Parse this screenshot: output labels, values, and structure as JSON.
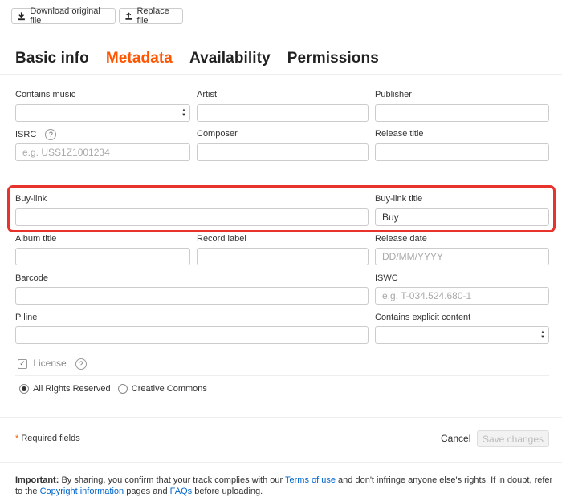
{
  "toolbar": {
    "download_label": "Download original file",
    "replace_label": "Replace file"
  },
  "tabs": [
    "Basic info",
    "Metadata",
    "Availability",
    "Permissions"
  ],
  "active_tab": "Metadata",
  "fields": {
    "contains_music": {
      "label": "Contains music",
      "value": ""
    },
    "artist": {
      "label": "Artist",
      "value": ""
    },
    "publisher": {
      "label": "Publisher",
      "value": ""
    },
    "isrc": {
      "label": "ISRC",
      "placeholder": "e.g. USS1Z1001234"
    },
    "composer": {
      "label": "Composer",
      "value": ""
    },
    "release_title": {
      "label": "Release title",
      "value": ""
    },
    "buy_link": {
      "label": "Buy-link",
      "value": ""
    },
    "buy_link_title": {
      "label": "Buy-link title",
      "value": "Buy"
    },
    "album_title": {
      "label": "Album title",
      "value": ""
    },
    "record_label": {
      "label": "Record label",
      "value": ""
    },
    "release_date": {
      "label": "Release date",
      "placeholder": "DD/MM/YYYY"
    },
    "barcode": {
      "label": "Barcode",
      "value": ""
    },
    "iswc": {
      "label": "ISWC",
      "placeholder": "e.g. T-034.524.680-1"
    },
    "p_line": {
      "label": "P line",
      "value": ""
    },
    "explicit": {
      "label": "Contains explicit content",
      "value": ""
    }
  },
  "license": {
    "label": "License",
    "options": [
      "All Rights Reserved",
      "Creative Commons"
    ],
    "selected": "All Rights Reserved"
  },
  "footer": {
    "required_star": "*",
    "required_text": "Required fields",
    "cancel_label": "Cancel",
    "save_label": "Save changes"
  },
  "notice": {
    "important": "Important:",
    "text1": " By sharing, you confirm that your track complies with our ",
    "terms_link": "Terms of use",
    "text2": " and don't infringe anyone else's rights. If in doubt, refer to the ",
    "copyright_link": "Copyright information",
    "text3": " pages and ",
    "faqs_link": "FAQs",
    "text4": " before uploading."
  },
  "help_glyph": "?",
  "colors": {
    "accent": "#ff5500",
    "highlight": "#e8322c",
    "link": "#0066cc"
  }
}
